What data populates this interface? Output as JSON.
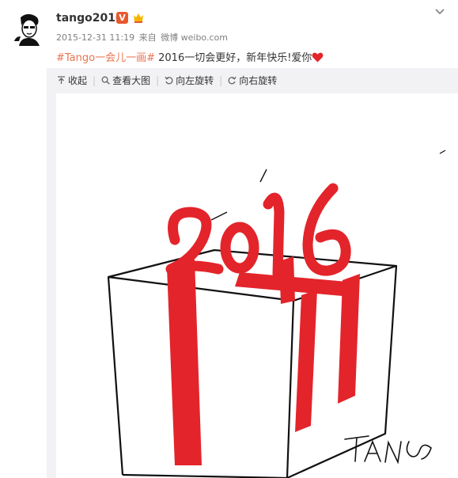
{
  "post": {
    "username": "tango2010",
    "verified_badge": "V",
    "timestamp": "2015-12-31 11:19",
    "source_prefix": "来自",
    "source": "微博 weibo.com",
    "topic": "#Tango一会儿一画#",
    "text": " 2016一切会更好，新年快乐!爱你"
  },
  "toolbar": {
    "collapse": "收起",
    "view_large": "查看大图",
    "rotate_left": "向左旋转",
    "rotate_right": "向右旋转"
  },
  "image": {
    "artwork_text": "2016",
    "signature": "TANGO"
  },
  "colors": {
    "topic": "#eb7350",
    "ribbon": "#e3242b",
    "verified": "#e8592d",
    "media_bg": "#f2f2f5"
  },
  "icons": [
    "avatar-icon",
    "verified-badge-icon",
    "member-badge-icon",
    "chevron-down-icon",
    "heart-icon",
    "collapse-icon",
    "search-icon",
    "rotate-left-icon",
    "rotate-right-icon"
  ]
}
